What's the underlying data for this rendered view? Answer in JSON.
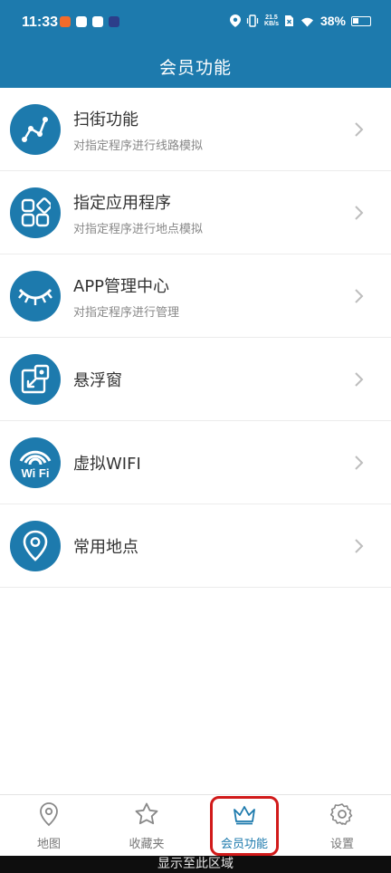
{
  "status_bar": {
    "time": "11:33",
    "net_speed_top": "21.5",
    "net_speed_bottom": "KB/s",
    "battery": "38%"
  },
  "app_bar": {
    "title": "会员功能"
  },
  "menu": {
    "items": [
      {
        "title": "扫街功能",
        "subtitle": "对指定程序进行线路模拟",
        "icon": "route-icon"
      },
      {
        "title": "指定应用程序",
        "subtitle": "对指定程序进行地点模拟",
        "icon": "apps-icon"
      },
      {
        "title": "APP管理中心",
        "subtitle": "对指定程序进行管理",
        "icon": "eye-lashes-icon"
      },
      {
        "title": "悬浮窗",
        "subtitle": "",
        "icon": "floating-window-icon"
      },
      {
        "title": "虚拟WIFI",
        "subtitle": "",
        "icon": "wifi-icon",
        "icon_text": "Wi Fi"
      },
      {
        "title": "常用地点",
        "subtitle": "",
        "icon": "map-pin-icon"
      }
    ]
  },
  "tab_bar": {
    "tabs": [
      {
        "label": "地图",
        "icon": "location-icon",
        "active": false
      },
      {
        "label": "收藏夹",
        "icon": "star-icon",
        "active": false
      },
      {
        "label": "会员功能",
        "icon": "crown-icon",
        "active": true
      },
      {
        "label": "设置",
        "icon": "gear-icon",
        "active": false
      }
    ]
  },
  "overlay": {
    "region_label": "显示至此区域"
  },
  "colors": {
    "primary": "#1d7aad",
    "highlight_border": "#d11a1a"
  }
}
